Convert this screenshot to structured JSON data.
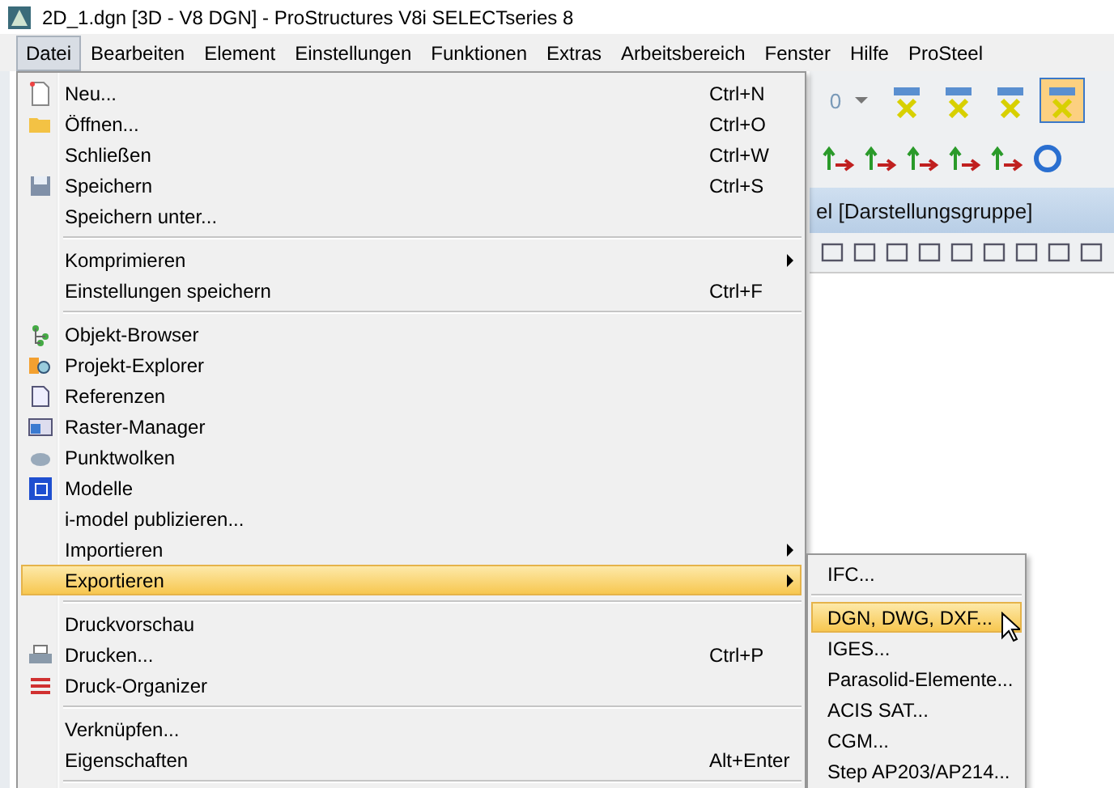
{
  "window": {
    "title": "2D_1.dgn [3D - V8 DGN] - ProStructures V8i SELECTseries 8"
  },
  "menubar": [
    {
      "label": "Datei",
      "selected": true
    },
    {
      "label": "Bearbeiten",
      "selected": false
    },
    {
      "label": "Element",
      "selected": false
    },
    {
      "label": "Einstellungen",
      "selected": false
    },
    {
      "label": "Funktionen",
      "selected": false
    },
    {
      "label": "Extras",
      "selected": false
    },
    {
      "label": "Arbeitsbereich",
      "selected": false
    },
    {
      "label": "Fenster",
      "selected": false
    },
    {
      "label": "Hilfe",
      "selected": false
    },
    {
      "label": "ProSteel",
      "selected": false
    }
  ],
  "toolbar": {
    "value": "0",
    "buttons": [
      {
        "selected": false
      },
      {
        "selected": false
      },
      {
        "selected": false
      },
      {
        "selected": true
      }
    ]
  },
  "view_title": "el [Darstellungsgruppe]",
  "file_menu": [
    {
      "kind": "item",
      "label": "Neu...",
      "shortcut": "Ctrl+N",
      "selected": false
    },
    {
      "kind": "item",
      "label": "Öffnen...",
      "shortcut": "Ctrl+O",
      "selected": false
    },
    {
      "kind": "item",
      "label": "Schließen",
      "shortcut": "Ctrl+W",
      "selected": false
    },
    {
      "kind": "item",
      "label": "Speichern",
      "shortcut": "Ctrl+S",
      "selected": false
    },
    {
      "kind": "item",
      "label": "Speichern unter...",
      "selected": false
    },
    {
      "kind": "separator"
    },
    {
      "kind": "submenu",
      "label": "Komprimieren",
      "selected": false
    },
    {
      "kind": "item",
      "label": "Einstellungen speichern",
      "shortcut": "Ctrl+F",
      "selected": false
    },
    {
      "kind": "separator"
    },
    {
      "kind": "item",
      "label": "Objekt-Browser",
      "selected": false
    },
    {
      "kind": "item",
      "label": "Projekt-Explorer",
      "selected": false
    },
    {
      "kind": "item",
      "label": "Referenzen",
      "selected": false
    },
    {
      "kind": "item",
      "label": "Raster-Manager",
      "selected": false
    },
    {
      "kind": "item",
      "label": "Punktwolken",
      "selected": false
    },
    {
      "kind": "item",
      "label": "Modelle",
      "selected": false
    },
    {
      "kind": "item",
      "label": "i-model publizieren...",
      "selected": false
    },
    {
      "kind": "submenu",
      "label": "Importieren",
      "selected": false
    },
    {
      "kind": "submenu",
      "label": "Exportieren",
      "selected": true
    },
    {
      "kind": "separator"
    },
    {
      "kind": "item",
      "label": "Druckvorschau",
      "selected": false
    },
    {
      "kind": "item",
      "label": "Drucken...",
      "shortcut": "Ctrl+P",
      "selected": false
    },
    {
      "kind": "item",
      "label": "Druck-Organizer",
      "selected": false
    },
    {
      "kind": "separator"
    },
    {
      "kind": "item",
      "label": "Verknüpfen...",
      "selected": false
    },
    {
      "kind": "item",
      "label": "Eigenschaften",
      "shortcut": "Alt+Enter",
      "selected": false
    },
    {
      "kind": "separator"
    }
  ],
  "export_menu": [
    {
      "kind": "item",
      "label": "IFC...",
      "selected": false
    },
    {
      "kind": "separator"
    },
    {
      "kind": "item",
      "label": "DGN, DWG, DXF...",
      "selected": true
    },
    {
      "kind": "item",
      "label": "IGES...",
      "selected": false
    },
    {
      "kind": "item",
      "label": "Parasolid-Elemente...",
      "selected": false
    },
    {
      "kind": "item",
      "label": "ACIS SAT...",
      "selected": false
    },
    {
      "kind": "item",
      "label": "CGM...",
      "selected": false
    },
    {
      "kind": "item",
      "label": "Step AP203/AP214...",
      "selected": false
    }
  ]
}
